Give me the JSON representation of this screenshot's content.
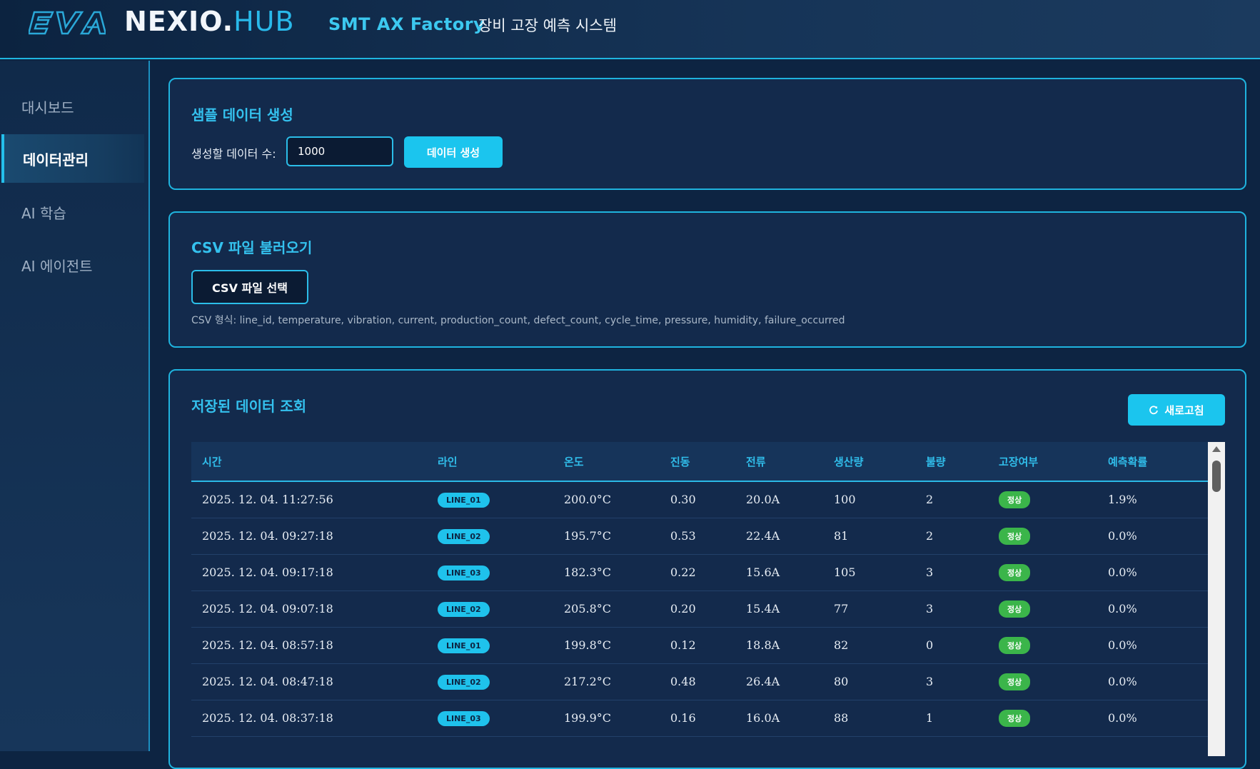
{
  "header": {
    "logo_text": "EVA",
    "brand_main": "NEXIO.",
    "brand_accent": "HUB",
    "factory": "SMT AX Factory",
    "system_title": "장비 고장 예측 시스템"
  },
  "sidebar": {
    "items": [
      {
        "label": "대시보드"
      },
      {
        "label": "데이터관리"
      },
      {
        "label": "AI 학습"
      },
      {
        "label": "AI 에이전트"
      }
    ]
  },
  "sample": {
    "title": "샘플 데이터 생성",
    "count_label": "생성할 데이터 수:",
    "count_value": "1000",
    "generate_label": "데이터 생성"
  },
  "csv": {
    "title": "CSV 파일 불러오기",
    "select_label": "CSV 파일 선택",
    "format_hint": "CSV 형식: line_id, temperature, vibration, current, production_count, defect_count, cycle_time, pressure, humidity, failure_occurred"
  },
  "stored": {
    "title": "저장된 데이터 조회",
    "refresh_icon": "refresh-icon",
    "refresh_label": "새로고침",
    "columns": [
      "시간",
      "라인",
      "온도",
      "진동",
      "전류",
      "생산량",
      "불량",
      "고장여부",
      "예측확률"
    ],
    "rows": [
      {
        "time": "2025. 12. 04. 11:27:56",
        "line": "LINE_01",
        "temp": "200.0°C",
        "vib": "0.30",
        "current": "20.0A",
        "prod": "100",
        "defect": "2",
        "status": "정상",
        "prob": "1.9%"
      },
      {
        "time": "2025. 12. 04. 09:27:18",
        "line": "LINE_02",
        "temp": "195.7°C",
        "vib": "0.53",
        "current": "22.4A",
        "prod": "81",
        "defect": "2",
        "status": "정상",
        "prob": "0.0%"
      },
      {
        "time": "2025. 12. 04. 09:17:18",
        "line": "LINE_03",
        "temp": "182.3°C",
        "vib": "0.22",
        "current": "15.6A",
        "prod": "105",
        "defect": "3",
        "status": "정상",
        "prob": "0.0%"
      },
      {
        "time": "2025. 12. 04. 09:07:18",
        "line": "LINE_02",
        "temp": "205.8°C",
        "vib": "0.20",
        "current": "15.4A",
        "prod": "77",
        "defect": "3",
        "status": "정상",
        "prob": "0.0%"
      },
      {
        "time": "2025. 12. 04. 08:57:18",
        "line": "LINE_01",
        "temp": "199.8°C",
        "vib": "0.12",
        "current": "18.8A",
        "prod": "82",
        "defect": "0",
        "status": "정상",
        "prob": "0.0%"
      },
      {
        "time": "2025. 12. 04. 08:47:18",
        "line": "LINE_02",
        "temp": "217.2°C",
        "vib": "0.48",
        "current": "26.4A",
        "prod": "80",
        "defect": "3",
        "status": "정상",
        "prob": "0.0%"
      },
      {
        "time": "2025. 12. 04. 08:37:18",
        "line": "LINE_03",
        "temp": "199.9°C",
        "vib": "0.16",
        "current": "16.0A",
        "prod": "88",
        "defect": "1",
        "status": "정상",
        "prob": "0.0%"
      }
    ]
  },
  "colors": {
    "accent": "#1fc2ec",
    "background": "#0d2442",
    "card": "#132a4c",
    "ok": "#3bb54a"
  }
}
